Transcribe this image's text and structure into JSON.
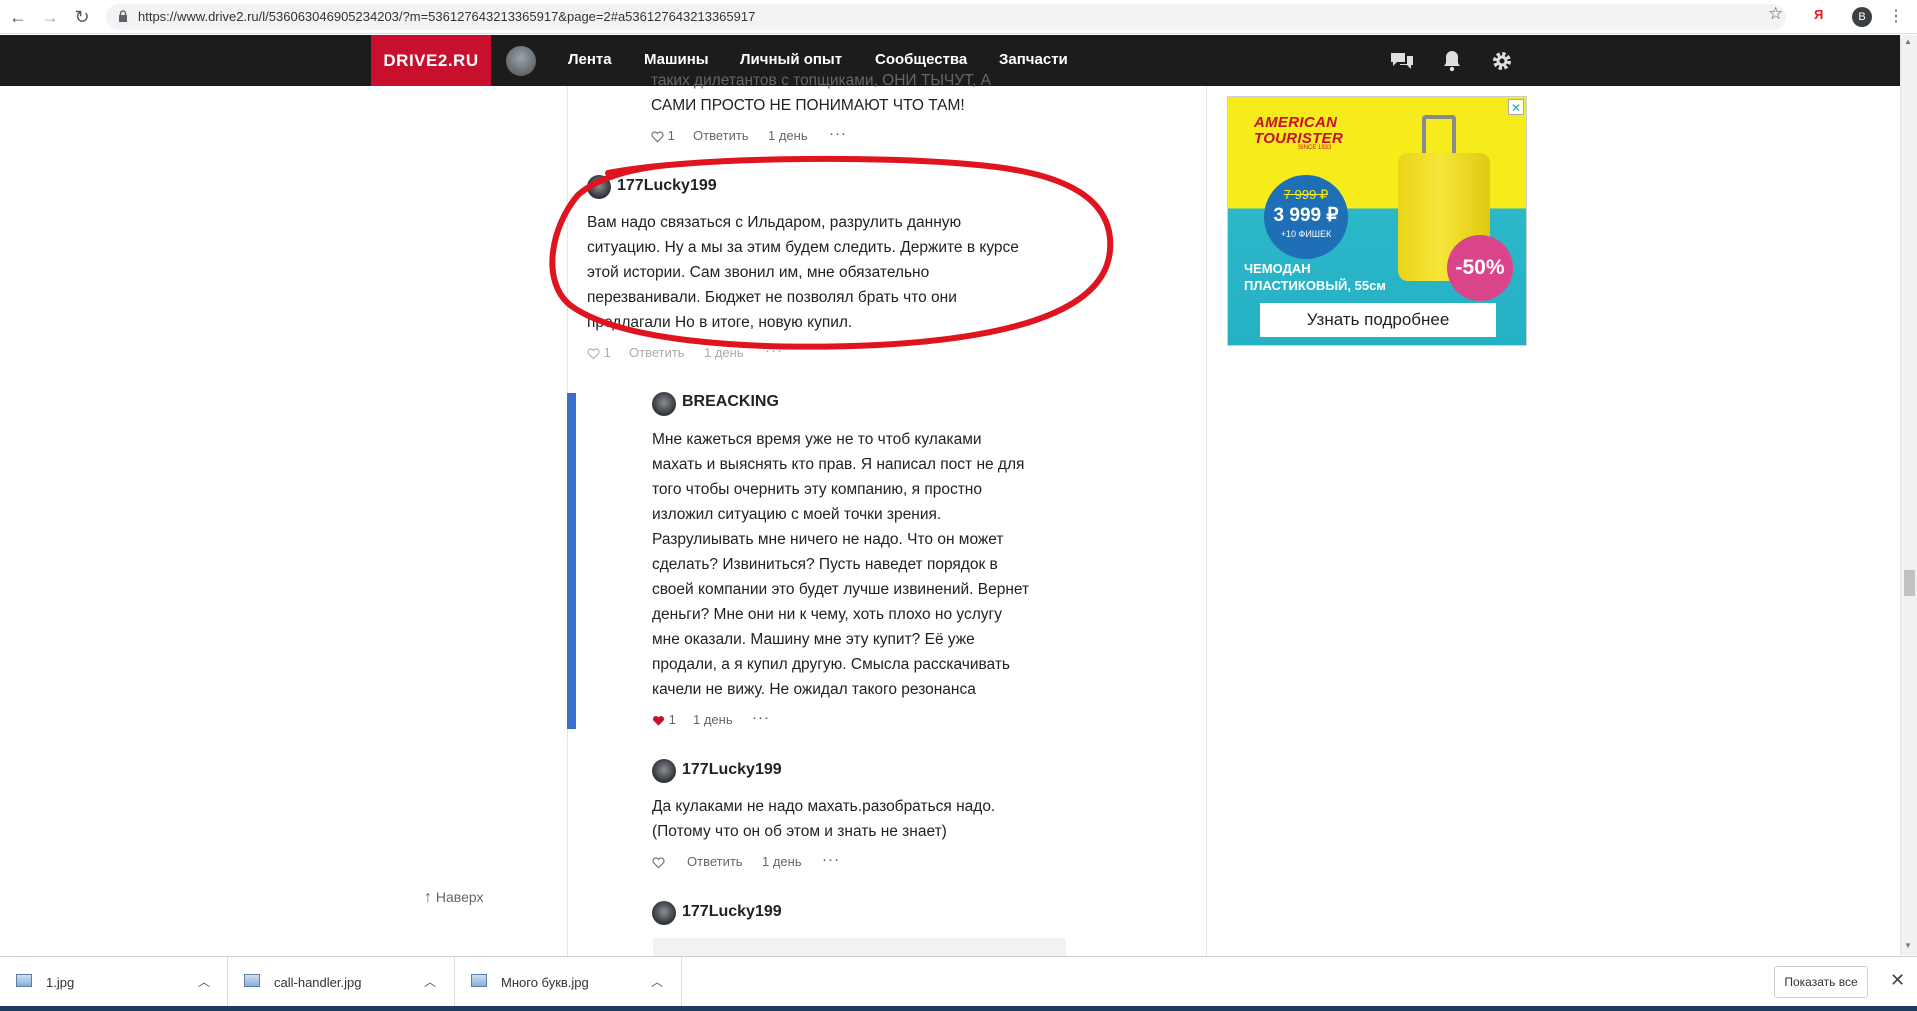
{
  "browser": {
    "url": "https://www.drive2.ru/l/536063046905234203/?m=536127643213365917&page=2#a536127643213365917",
    "ya_label": "Я",
    "profile_letter": "B"
  },
  "header": {
    "logo": "DRIVE2.RU",
    "nav": [
      "Лента",
      "Машины",
      "Личный опыт",
      "Сообщества",
      "Запчасти"
    ]
  },
  "comments": {
    "prev": {
      "text_lines": [
        "таких дилетантов с топщиками, ОНИ ТЫЧУТ, А",
        "САМИ ПРОСТО НЕ ПОНИМАЮТ ЧТО ТАМ!"
      ],
      "likes": "1",
      "reply": "Ответить",
      "time": "1 день",
      "more": "···"
    },
    "highlighted": {
      "author": "177Lucky199",
      "text_lines": [
        "Вам надо связаться с Ильдаром, разрулить данную",
        "ситуацию. Ну а мы за этим будем следить. Держите в курсе",
        "этой истории. Сам звонил им, мне обязательно",
        "перезванивали. Бюджет не позволял брать что они",
        "предлагали Но в итоге, новую купил."
      ],
      "likes": "1",
      "reply": "Ответить",
      "time": "1 день",
      "more": "···"
    },
    "reply1": {
      "author": "BREACKING",
      "text_lines": [
        "Мне кажеться время уже не то чтоб кулаками",
        "махать и выяснять кто прав. Я написал пост не для",
        "того чтобы очернить эту компанию, я простно",
        "изложил ситуацию с моей точки зрения.",
        "Разрулиывать мне ничего не надо. Что он может",
        "сделать? Извиниться? Пусть наведет порядок в",
        "своей компании это будет лучше извинений. Вернет",
        "деньги? Мне они ни к чему, хоть плохо но услугу",
        "мне оказали. Машину мне эту купит? Её уже",
        "продали, а я купил другую. Смысла расскачивать",
        "качели не вижу. Не ожидал такого резонанса"
      ],
      "likes": "1",
      "time": "1 день",
      "more": "···"
    },
    "reply2": {
      "author": "177Lucky199",
      "text_lines": [
        "Да кулаками не надо махать.разобраться надо.",
        "(Потому что он об этом и знать не знает)"
      ],
      "reply": "Ответить",
      "time": "1 день",
      "more": "···"
    },
    "reply3": {
      "author": "177Lucky199"
    }
  },
  "to_top": "Наверх",
  "ad": {
    "brand_line1": "AMERICAN",
    "brand_line2": "TOURISTER",
    "since": "SINCE 1933",
    "old_price": "7 999 ₽",
    "new_price": "3 999 ₽",
    "chips": "+10 ФИШЕК",
    "discount": "-50%",
    "desc_line1": "ЧЕМОДАН",
    "desc_line2": "ПЛАСТИКОВЫЙ, 55см",
    "cta": "Узнать подробнее",
    "close": "✕"
  },
  "downloads": {
    "items": [
      "1.jpg",
      "call-handler.jpg",
      "Много букв.jpg"
    ],
    "show_all": "Показать все"
  },
  "colors": {
    "logo_red": "#c8102e",
    "reply_bar_blue": "#3a6fcc",
    "annotation_red": "#e0141e",
    "liked_heart": "#c8102e"
  }
}
